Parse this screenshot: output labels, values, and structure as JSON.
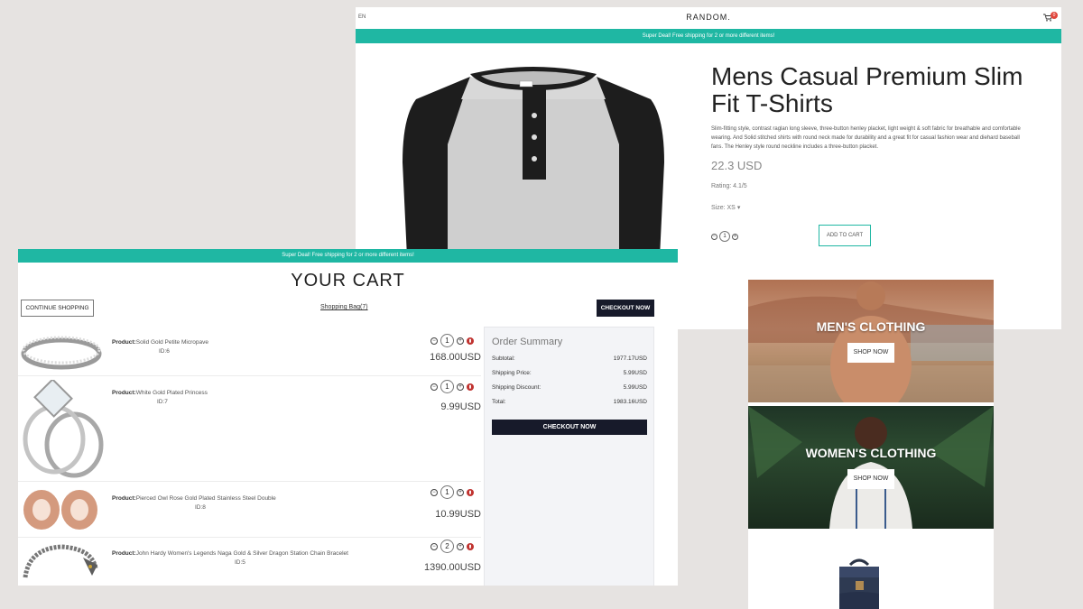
{
  "product_page": {
    "lang": "EN",
    "logo": "RANDOM.",
    "cart_count": "0",
    "promo": "Super Deal! Free shipping for 2 or more different items!",
    "product": {
      "title": "Mens Casual Premium Slim Fit T-Shirts",
      "description": "Slim-fitting style, contrast raglan long sleeve, three-button henley placket, light weight & soft fabric for breathable and comfortable wearing. And Solid stitched shirts with round neck made for durability and a great fit for casual fashion wear and diehard baseball fans. The Henley style round neckline includes a three-button placket.",
      "price": "22.3 USD",
      "rating": "Rating: 4.1/5",
      "size_label": "Size:",
      "size_value": "XS",
      "quantity": "1",
      "add_to_cart": "ADD TO CART"
    }
  },
  "categories": [
    {
      "title": "MEN'S CLOTHING",
      "button": "SHOP NOW"
    },
    {
      "title": "WOMEN'S CLOTHING",
      "button": "SHOP NOW"
    }
  ],
  "cart_page": {
    "promo": "Super Deal! Free shipping for 2 or more different items!",
    "title": "YOUR CART",
    "continue_label": "CONTINUE SHOPPING",
    "bag_link": "Shopping Bag(7)",
    "checkout_top": "CHECKOUT NOW",
    "product_label": "Product:",
    "items": [
      {
        "name": "Solid Gold Petite Micropave",
        "id": "ID:6",
        "qty": "1",
        "price": "168.00USD"
      },
      {
        "name": "White Gold Plated Princess",
        "id": "ID:7",
        "qty": "1",
        "price": "9.99USD"
      },
      {
        "name": "Pierced Owl Rose Gold Plated Stainless Steel Double",
        "id": "ID:8",
        "qty": "1",
        "price": "10.99USD"
      },
      {
        "name": "John Hardy Women's Legends Naga Gold & Silver Dragon Station Chain Bracelet",
        "id": "ID:5",
        "qty": "2",
        "price": "1390.00USD"
      }
    ],
    "summary": {
      "title": "Order Summary",
      "rows": [
        {
          "label": "Subtotal:",
          "value": "1977.17USD"
        },
        {
          "label": "Shipping Price:",
          "value": "5.99USD"
        },
        {
          "label": "Shipping Discount:",
          "value": "5.99USD"
        },
        {
          "label": "Total:",
          "value": "1983.16USD"
        }
      ],
      "checkout": "CHECKOUT NOW"
    }
  },
  "colors": {
    "accent": "#1fb7a3",
    "dark_button": "#171a2a",
    "delete": "#c0322f",
    "page_bg": "#e6e3e1"
  }
}
